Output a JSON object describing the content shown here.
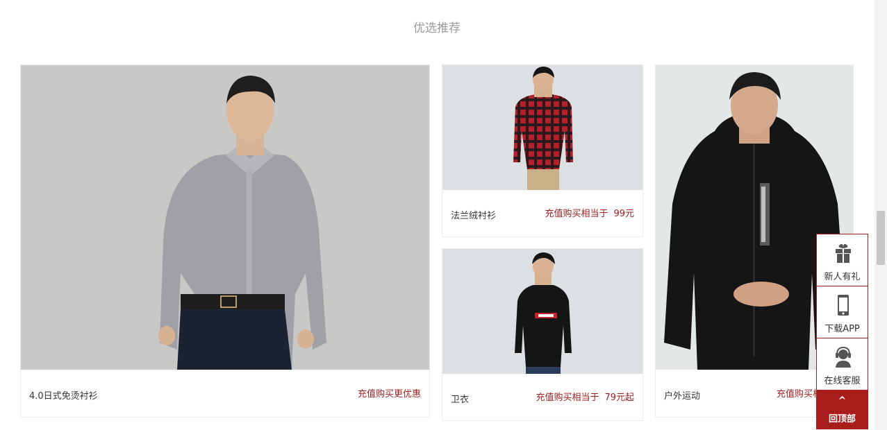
{
  "section": {
    "title": "优选推荐"
  },
  "products": {
    "shirt": {
      "name": "4.0日式免烫衬衫",
      "promo": "充值购买更优惠",
      "price": ""
    },
    "flannel": {
      "name": "法兰绒衬衫",
      "promo": "充值购买相当于",
      "price": "99元"
    },
    "hoodie": {
      "name": "卫衣",
      "promo": "充值购买相当于",
      "price": "79元起"
    },
    "outdoor": {
      "name": "户外运动",
      "promo": "充值购买相当于",
      "price": ""
    }
  },
  "float_bar": {
    "gift": {
      "label": "新人有礼",
      "icon": "gift-icon"
    },
    "app": {
      "label": "下载APP",
      "icon": "phone-icon"
    },
    "service": {
      "label": "在线客服",
      "icon": "customer-service-icon"
    },
    "top": {
      "label": "回顶部",
      "icon": "caret-up-icon",
      "caret": "^"
    }
  },
  "colors": {
    "accent": "#a81c1c",
    "promo_text": "#9b1c1c",
    "title": "#999999"
  }
}
